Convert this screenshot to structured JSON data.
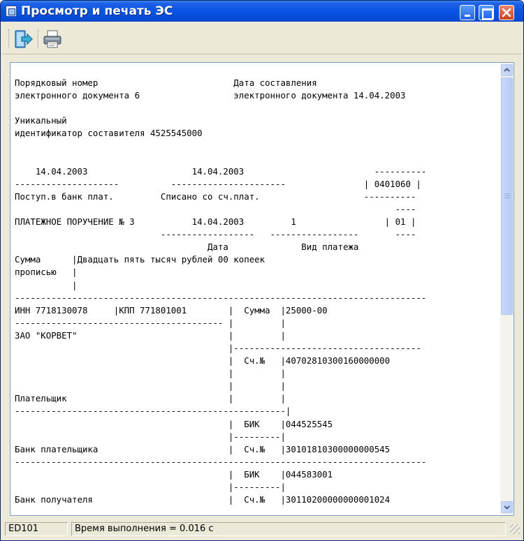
{
  "window": {
    "title": "Просмотр и печать ЭС"
  },
  "toolbar": {
    "buttons": [
      {
        "icon": "exit-icon",
        "label": ""
      },
      {
        "icon": "printer-icon",
        "label": ""
      }
    ]
  },
  "document": {
    "lines": [
      "Порядковый номер                          Дата составления",
      "электронного документа 6                  электронного документа 14.04.2003",
      "",
      "Уникальный",
      "идентификатор составителя 4525545000",
      "",
      "",
      "    14.04.2003                    14.04.2003                         ----------",
      "--------------------          ----------------------               | 0401060 |",
      "Поступ.в банк плат.         Списано со сч.плат.                    ----------",
      "                                                                         ----",
      "ПЛАТЕЖНОЕ ПОРУЧЕНИЕ № 3           14.04.2003         1                 | 01 |",
      "                            ------------------   -----------------       ----",
      "                                     Дата              Вид платежа",
      "Сумма      |Двадцать пять тысяч рублей 00 копеек",
      "прописью   |",
      "           |",
      "-------------------------------------------------------------------------------",
      "ИНН 7718130078     |КПП 771801001        |  Сумма  |25000-00",
      "---------------------------------------- |         |",
      "ЗАО \"КОРВЕТ\"                             |         |",
      "                                         |------------------------------------",
      "                                         |  Сч.№   |40702810300160000000",
      "                                         |         |",
      "                                         |         |",
      "Плательщик                               |         |",
      "----------------------------------------------------|",
      "                                         |  БИК    |044525545",
      "                                         |---------|",
      "Банк плательщика                         |  Сч.№   |30101810300000000545",
      "-------------------------------------------------------------------------------",
      "                                         |  БИК    |044583001",
      "                                         |---------|",
      "Банк получателя                          |  Сч.№   |30110200000000001024"
    ]
  },
  "statusbar": {
    "code": "ED101",
    "message": "Время выполнения = 0.016 с"
  }
}
